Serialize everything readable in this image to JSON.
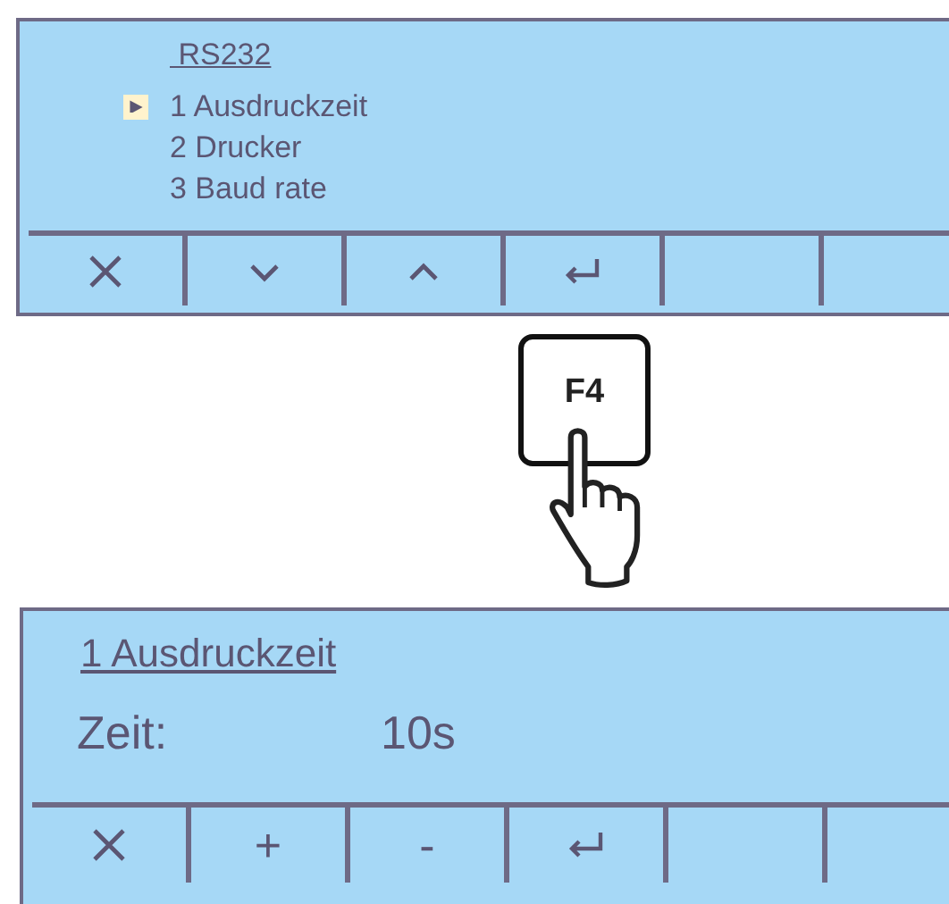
{
  "screens": [
    {
      "title": "RS232",
      "menu": [
        {
          "label": "1 Ausdruckzeit",
          "selected": true
        },
        {
          "label": "2 Drucker",
          "selected": false
        },
        {
          "label": "3 Baud rate",
          "selected": false
        }
      ],
      "softkeys": [
        {
          "kind": "close"
        },
        {
          "kind": "down"
        },
        {
          "kind": "up"
        },
        {
          "kind": "enter"
        },
        {
          "kind": "empty"
        },
        {
          "kind": "empty"
        }
      ]
    },
    {
      "title": "1 Ausdruckzeit",
      "field": {
        "label": "Zeit:",
        "value": "10s"
      },
      "softkeys": [
        {
          "kind": "close"
        },
        {
          "kind": "text",
          "label": "+"
        },
        {
          "kind": "text",
          "label": "-"
        },
        {
          "kind": "enter"
        },
        {
          "kind": "empty"
        },
        {
          "kind": "empty"
        }
      ]
    }
  ],
  "key": {
    "label": "F4"
  }
}
